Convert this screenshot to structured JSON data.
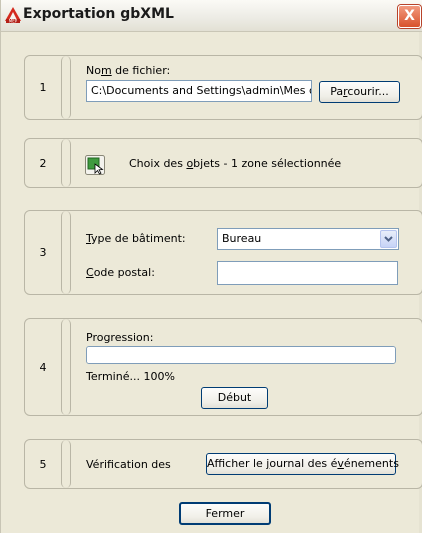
{
  "window": {
    "title": "Exportation gbXML",
    "close_glyph": "X"
  },
  "icons": {
    "app_icon": "autocad-a-icon",
    "select_objects_icon": "select-objects-icon",
    "dropdown_arrow": "chevron-down-icon"
  },
  "steps": {
    "s1": {
      "number": "1",
      "file_label_pre": "No",
      "file_label_key": "m",
      "file_label_post": " de fichier:",
      "file_value": "C:\\Documents and Settings\\admin\\Mes c",
      "browse_pre": "Pa",
      "browse_key": "r",
      "browse_post": "courir..."
    },
    "s2": {
      "number": "2",
      "choice_pre": "Choix des ",
      "choice_key": "o",
      "choice_post": "bjets - 1 zone sélectionnée"
    },
    "s3": {
      "number": "3",
      "type_key": "T",
      "type_post": "ype de bâtiment:",
      "type_value": "Bureau",
      "postal_key": "C",
      "postal_post": "ode postal:",
      "postal_value": ""
    },
    "s4": {
      "number": "4",
      "progress_label": "Progression:",
      "progress_fraction": 1.0,
      "status": "Terminé... 100%",
      "start_label": "Début"
    },
    "s5": {
      "number": "5",
      "verify_label": "Vérification des",
      "log_pre": "Afficher le ",
      "log_key": "j",
      "log_mid": "ournal des é",
      "log_key2": "v",
      "log_post": "énements"
    }
  },
  "footer": {
    "close_label": "Fermer"
  },
  "colors": {
    "dialog_bg": "#ece9d8",
    "field_border": "#7f9db9",
    "button_border": "#003c74",
    "close_red": "#d8522c"
  }
}
